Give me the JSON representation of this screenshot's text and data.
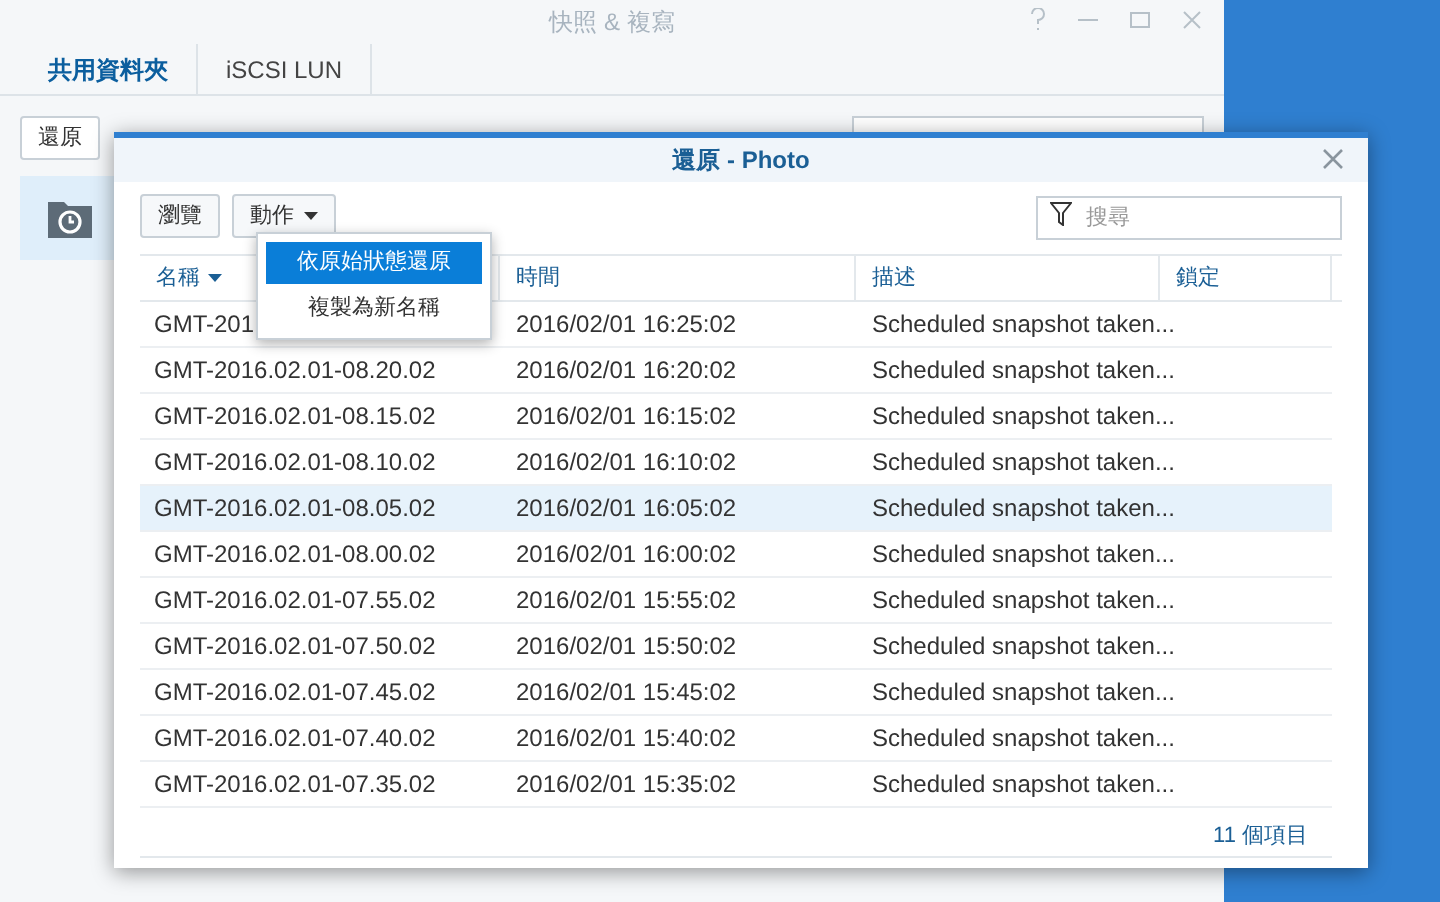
{
  "main_window": {
    "title": "快照 & 複寫",
    "tabs": [
      {
        "label": "共用資料夾",
        "selected": true
      },
      {
        "label": "iSCSI LUN",
        "selected": false
      }
    ],
    "toolbar_button": "還原"
  },
  "dialog": {
    "title": "還原 - Photo",
    "buttons": [
      {
        "label": "瀏覽",
        "kind": "button"
      },
      {
        "label": "動作",
        "kind": "dropdown"
      }
    ],
    "search": {
      "placeholder": "搜尋"
    },
    "menu": [
      {
        "label": "依原始狀態還原",
        "selected": true
      },
      {
        "label": "複製為新名稱",
        "selected": false
      }
    ],
    "table": {
      "columns": [
        {
          "label": "名稱",
          "sorted": true
        },
        {
          "label": "時間",
          "sorted": false
        },
        {
          "label": "描述",
          "sorted": false
        },
        {
          "label": "鎖定",
          "sorted": false
        }
      ],
      "rows": [
        {
          "name": "GMT-201",
          "time": "2016/02/01 16:25:02",
          "description": "Scheduled snapshot taken...",
          "selected": false
        },
        {
          "name": "GMT-2016.02.01-08.20.02",
          "time": "2016/02/01 16:20:02",
          "description": "Scheduled snapshot taken...",
          "selected": false
        },
        {
          "name": "GMT-2016.02.01-08.15.02",
          "time": "2016/02/01 16:15:02",
          "description": "Scheduled snapshot taken...",
          "selected": false
        },
        {
          "name": "GMT-2016.02.01-08.10.02",
          "time": "2016/02/01 16:10:02",
          "description": "Scheduled snapshot taken...",
          "selected": false
        },
        {
          "name": "GMT-2016.02.01-08.05.02",
          "time": "2016/02/01 16:05:02",
          "description": "Scheduled snapshot taken...",
          "selected": true
        },
        {
          "name": "GMT-2016.02.01-08.00.02",
          "time": "2016/02/01 16:00:02",
          "description": "Scheduled snapshot taken...",
          "selected": false
        },
        {
          "name": "GMT-2016.02.01-07.55.02",
          "time": "2016/02/01 15:55:02",
          "description": "Scheduled snapshot taken...",
          "selected": false
        },
        {
          "name": "GMT-2016.02.01-07.50.02",
          "time": "2016/02/01 15:50:02",
          "description": "Scheduled snapshot taken...",
          "selected": false
        },
        {
          "name": "GMT-2016.02.01-07.45.02",
          "time": "2016/02/01 15:45:02",
          "description": "Scheduled snapshot taken...",
          "selected": false
        },
        {
          "name": "GMT-2016.02.01-07.40.02",
          "time": "2016/02/01 15:40:02",
          "description": "Scheduled snapshot taken...",
          "selected": false
        },
        {
          "name": "GMT-2016.02.01-07.35.02",
          "time": "2016/02/01 15:35:02",
          "description": "Scheduled snapshot taken...",
          "selected": false
        }
      ]
    },
    "footer": "11 個項目"
  }
}
